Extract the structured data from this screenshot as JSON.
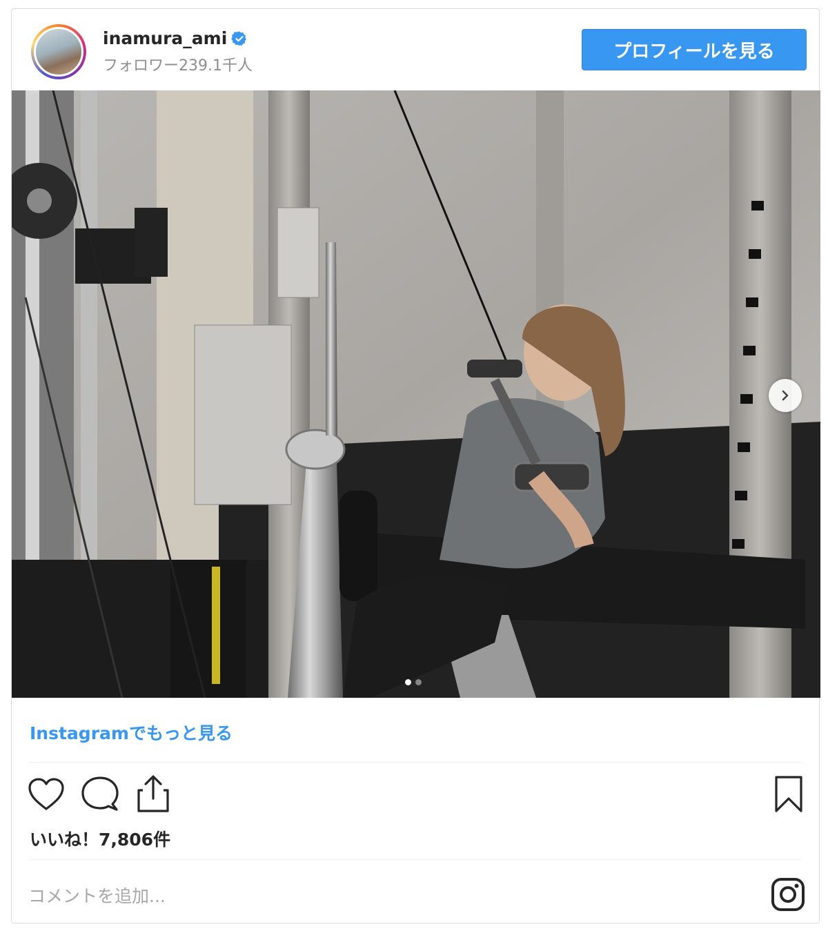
{
  "header": {
    "username": "inamura_ami",
    "followers": "フォロワー239.1千人",
    "profile_button": "プロフィールを見る"
  },
  "post": {
    "carousel_count": 2,
    "carousel_active": 1
  },
  "footer": {
    "more_link": "Instagramでもっと見る",
    "likes": "いいね！7,806件",
    "comment_placeholder": "コメントを追加..."
  },
  "icons": [
    "verified-icon",
    "heart-icon",
    "comment-icon",
    "share-icon",
    "bookmark-icon",
    "instagram-icon",
    "chevron-right-icon"
  ],
  "colors": {
    "accent": "#3897f0",
    "text": "#262626",
    "muted": "#8e8e8e",
    "border": "#dbdbdb"
  }
}
